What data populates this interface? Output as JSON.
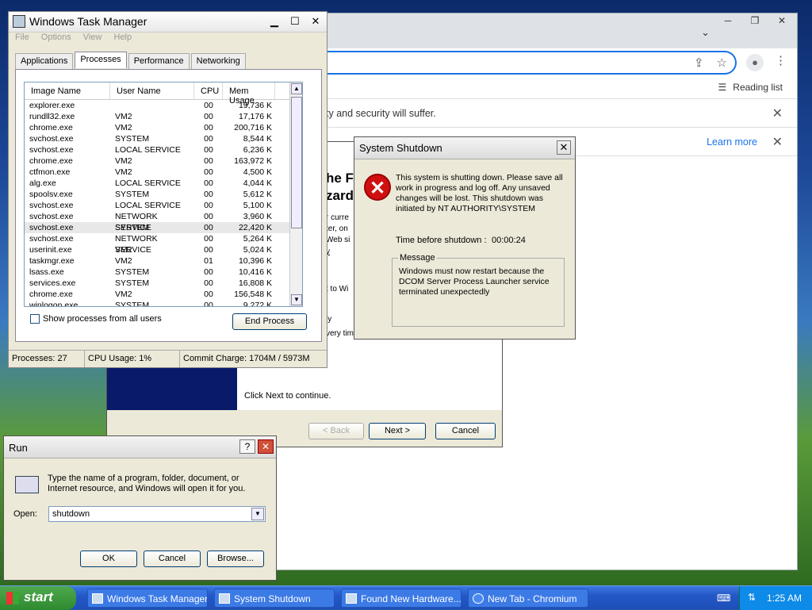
{
  "chromium": {
    "reading_list": "Reading list",
    "infobar_text": "ty and security will suffer.",
    "learn_more": "Learn more"
  },
  "wizard": {
    "title_frag1": "he F",
    "title_frag2": "zard",
    "frags": [
      "r curre",
      "ter, on",
      "Web si",
      "y",
      "t to Wi",
      "ly",
      "very tim"
    ],
    "next_text": "Click Next to continue.",
    "back_label": "< Back",
    "next_label": "Next >",
    "cancel_label": "Cancel"
  },
  "taskmgr": {
    "title": "Windows Task Manager",
    "menu": [
      "File",
      "Options",
      "View",
      "Help"
    ],
    "tabs": [
      "Applications",
      "Processes",
      "Performance",
      "Networking"
    ],
    "columns": [
      "Image Name",
      "User Name",
      "CPU",
      "Mem Usage"
    ],
    "rows": [
      [
        "explorer.exe",
        "",
        "00",
        "19,736 K"
      ],
      [
        "rundll32.exe",
        "VM2",
        "00",
        "17,176 K"
      ],
      [
        "chrome.exe",
        "VM2",
        "00",
        "200,716 K"
      ],
      [
        "svchost.exe",
        "SYSTEM",
        "00",
        "8,544 K"
      ],
      [
        "svchost.exe",
        "LOCAL SERVICE",
        "00",
        "6,236 K"
      ],
      [
        "chrome.exe",
        "VM2",
        "00",
        "163,972 K"
      ],
      [
        "ctfmon.exe",
        "VM2",
        "00",
        "4,500 K"
      ],
      [
        "alg.exe",
        "LOCAL SERVICE",
        "00",
        "4,044 K"
      ],
      [
        "spoolsv.exe",
        "SYSTEM",
        "00",
        "5,612 K"
      ],
      [
        "svchost.exe",
        "LOCAL SERVICE",
        "00",
        "5,100 K"
      ],
      [
        "svchost.exe",
        "NETWORK SERVICE",
        "00",
        "3,960 K"
      ],
      [
        "svchost.exe",
        "SYSTEM",
        "00",
        "22,420 K"
      ],
      [
        "svchost.exe",
        "NETWORK SERVICE",
        "00",
        "5,264 K"
      ],
      [
        "userinit.exe",
        "VM2",
        "00",
        "5,024 K"
      ],
      [
        "taskmgr.exe",
        "VM2",
        "01",
        "10,396 K"
      ],
      [
        "lsass.exe",
        "SYSTEM",
        "00",
        "10,416 K"
      ],
      [
        "services.exe",
        "SYSTEM",
        "00",
        "16,808 K"
      ],
      [
        "chrome.exe",
        "VM2",
        "00",
        "156,548 K"
      ],
      [
        "winlogon.exe",
        "SYSTEM",
        "00",
        "9,272 K"
      ]
    ],
    "selected_row": 11,
    "show_all_label": "Show processes from all users",
    "end_process_label": "End Process",
    "status": {
      "processes": "Processes: 27",
      "cpu": "CPU Usage: 1%",
      "commit": "Commit Charge: 1704M / 5973M"
    }
  },
  "shutdown": {
    "title": "System Shutdown",
    "message": "This system is shutting down. Please save all work in progress and log off. Any unsaved changes will be lost. This shutdown was initiated by NT AUTHORITY\\SYSTEM",
    "time_label": "Time before shutdown :",
    "time_value": "00:00:24",
    "group_label": "Message",
    "group_text": "Windows must now restart because the DCOM Server Process Launcher service terminated unexpectedly"
  },
  "run": {
    "title": "Run",
    "help": "?",
    "description": "Type the name of a program, folder, document, or Internet resource, and Windows will open it for you.",
    "open_label": "Open:",
    "open_value": "shutdown",
    "ok_label": "OK",
    "cancel_label": "Cancel",
    "browse_label": "Browse..."
  },
  "taskbar": {
    "start_label": "start",
    "buttons": [
      "Windows Task Manager",
      "System Shutdown",
      "Found New Hardware...",
      "New Tab - Chromium"
    ],
    "clock": "1:25 AM"
  }
}
